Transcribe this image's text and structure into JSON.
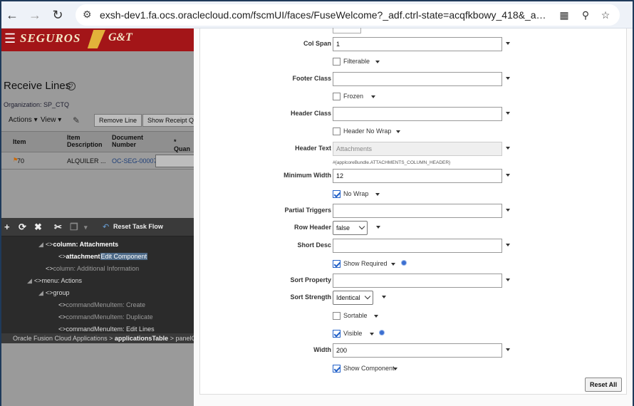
{
  "browser": {
    "url": "exsh-dev1.fa.ocs.oraclecloud.com/fscmUI/faces/FuseWelcome?_adf.ctrl-state=acqfkbowy_418&_afrLoop=2876..."
  },
  "app": {
    "brand": "SEGUROS",
    "brand_suffix": "G&T",
    "page_title": "Receive Lines",
    "organization": "Organization: SP_CTQ",
    "toolbar": {
      "actions": "Actions",
      "view": "View",
      "remove_line": "Remove Line",
      "show_receipt": "Show Receipt Qu"
    },
    "table": {
      "headers": [
        "Item",
        "Item Description",
        "Document Number",
        "* Quan"
      ],
      "rows": [
        {
          "item": "70",
          "description": "ALQUILER ...",
          "document": "OC-SEG-00007",
          "quantity": ""
        }
      ]
    },
    "structure": {
      "reset_task_flow": "Reset Task Flow",
      "nodes": [
        {
          "text": "column: Attachments",
          "level": 0
        },
        {
          "text": "attachment",
          "action": "Edit Component",
          "level": 1
        },
        {
          "text": "column: Additional Information",
          "level": 0
        },
        {
          "text": "menu: Actions",
          "level": -1
        },
        {
          "text": "group",
          "level": 0
        },
        {
          "text": "commandMenuItem: Create",
          "level": 1
        },
        {
          "text": "commandMenuItem: Duplicate",
          "level": 1
        },
        {
          "text": "commandMenuItem: Edit Lines",
          "level": 1
        }
      ],
      "breadcrumb_prefix": "Oracle Fusion Cloud Applications > ",
      "breadcrumb_bold": "applicationsTable",
      "breadcrumb_suffix": " > panelCollect"
    }
  },
  "properties": {
    "col_span": {
      "label": "Col Span",
      "value": "1"
    },
    "filterable": {
      "label": "Filterable",
      "checked": false
    },
    "footer_class": {
      "label": "Footer Class",
      "value": ""
    },
    "frozen": {
      "label": "Frozen",
      "checked": false
    },
    "header_class": {
      "label": "Header Class",
      "value": ""
    },
    "header_no_wrap": {
      "label": "Header No Wrap",
      "checked": false
    },
    "header_text": {
      "label": "Header Text",
      "value": "Attachments",
      "hint": "#{applcoreBundle.ATTACHMENTS_COLUMN_HEADER}"
    },
    "minimum_width": {
      "label": "Minimum Width",
      "value": "12"
    },
    "no_wrap": {
      "label": "No Wrap",
      "checked": true
    },
    "partial_triggers": {
      "label": "Partial Triggers",
      "value": ""
    },
    "row_header": {
      "label": "Row Header",
      "value": "false"
    },
    "short_desc": {
      "label": "Short Desc",
      "value": ""
    },
    "show_required": {
      "label": "Show Required",
      "checked": true
    },
    "sort_property": {
      "label": "Sort Property",
      "value": ""
    },
    "sort_strength": {
      "label": "Sort Strength",
      "value": "Identical"
    },
    "sortable": {
      "label": "Sortable",
      "checked": false
    },
    "visible": {
      "label": "Visible",
      "checked": true
    },
    "width": {
      "label": "Width",
      "value": "200"
    },
    "show_component": {
      "label": "Show Component",
      "checked": true
    },
    "reset_all": "Reset All"
  },
  "colors": {
    "brand_red": "#a31518",
    "check_blue": "#2563c9"
  }
}
